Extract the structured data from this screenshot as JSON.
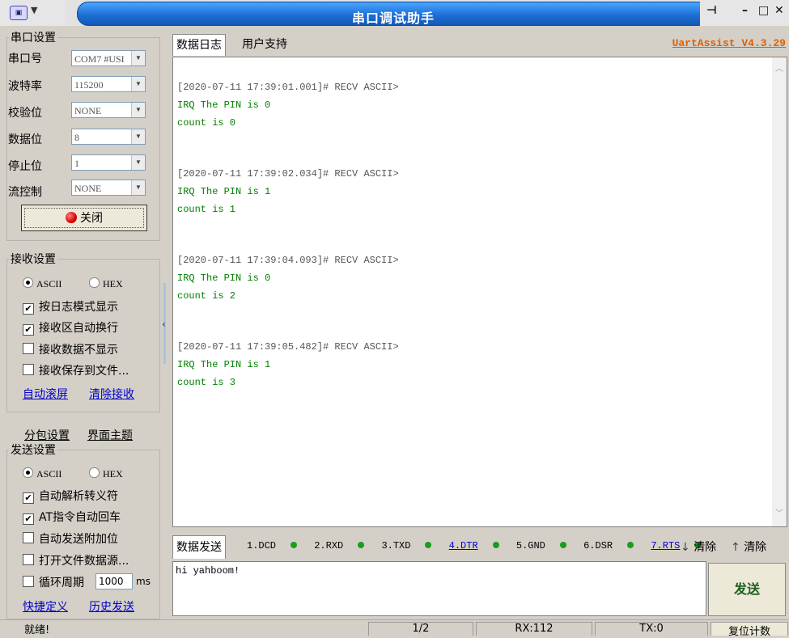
{
  "window": {
    "title": "串口调试助手",
    "version": "UartAssist V4.3.29"
  },
  "serial": {
    "legend": "串口设置",
    "port_label": "串口号",
    "port_value": "COM7 #USI",
    "baud_label": "波特率",
    "baud_value": "115200",
    "parity_label": "校验位",
    "parity_value": "NONE",
    "databits_label": "数据位",
    "databits_value": "8",
    "stopbits_label": "停止位",
    "stopbits_value": "1",
    "flow_label": "流控制",
    "flow_value": "NONE",
    "close_label": "关闭"
  },
  "receive": {
    "legend": "接收设置",
    "ascii": "ASCII",
    "hex": "HEX",
    "opt1": "按日志模式显示",
    "opt2": "接收区自动换行",
    "opt3": "接收数据不显示",
    "opt4": "接收保存到文件...",
    "link1": "自动滚屏",
    "link2": "清除接收"
  },
  "tabs2": {
    "t1": "分包设置",
    "t2": "界面主题"
  },
  "send": {
    "legend": "发送设置",
    "ascii": "ASCII",
    "hex": "HEX",
    "opt1": "自动解析转义符",
    "opt2": "AT指令自动回车",
    "opt3": "自动发送附加位",
    "opt4": "打开文件数据源...",
    "opt5": "循环周期",
    "period": "1000",
    "unit": "ms",
    "link1": "快捷定义",
    "link2": "历史发送"
  },
  "main_tabs": {
    "log": "数据日志",
    "support": "用户支持"
  },
  "log": {
    "entries": [
      {
        "header": "[2020-07-11 17:39:01.001]# RECV ASCII>",
        "line1": "IRQ The PIN is 0",
        "line2": "count is 0"
      },
      {
        "header": "[2020-07-11 17:39:02.034]# RECV ASCII>",
        "line1": "IRQ The PIN is 1",
        "line2": "count is 1"
      },
      {
        "header": "[2020-07-11 17:39:04.093]# RECV ASCII>",
        "line1": "IRQ The PIN is 0",
        "line2": "count is 2"
      },
      {
        "header": "[2020-07-11 17:39:05.482]# RECV ASCII>",
        "line1": "IRQ The PIN is 1",
        "line2": "count is 3"
      }
    ]
  },
  "sendbar": {
    "tab": "数据发送",
    "pins": [
      "1.DCD",
      "2.RXD",
      "3.TXD",
      "4.DTR",
      "5.GND",
      "6.DSR",
      "7.RTS"
    ],
    "clear1": "清除",
    "clear2": "清除",
    "input": "hi yahboom!",
    "send_label": "发送"
  },
  "status": {
    "ready": "就绪!",
    "c1": "1/2",
    "c2": "RX:112",
    "c3": "TX:0",
    "reset": "复位计数"
  },
  "colors": {
    "title_blue": "#1d6fd6",
    "green_text": "#008000",
    "version_orange": "#e06000"
  }
}
